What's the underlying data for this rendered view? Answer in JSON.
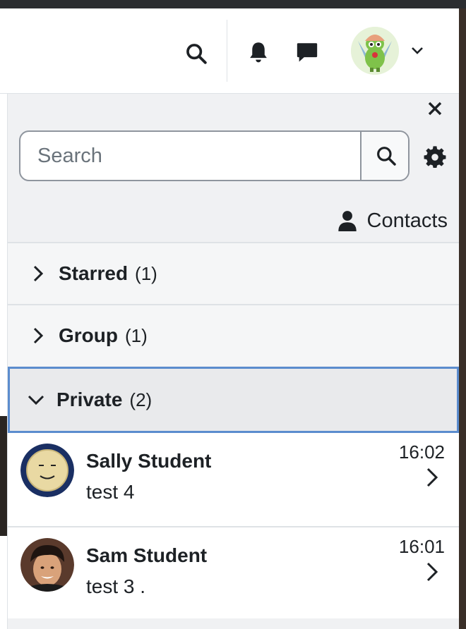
{
  "navbar": {
    "search_icon": "search-icon",
    "notifications_icon": "bell-icon",
    "messages_icon": "chat-bubble-icon",
    "user_menu_icon": "chevron-down-icon"
  },
  "drawer": {
    "search": {
      "placeholder": "Search"
    },
    "contacts_label": "Contacts",
    "sections": [
      {
        "label": "Starred",
        "count": "(1)",
        "expanded": false
      },
      {
        "label": "Group",
        "count": "(1)",
        "expanded": false
      },
      {
        "label": "Private",
        "count": "(2)",
        "expanded": true
      }
    ],
    "conversations": [
      {
        "name": "Sally Student",
        "last_message": "test 4",
        "time": "16:02"
      },
      {
        "name": "Sam Student",
        "last_message": "test 3 .",
        "time": "16:01"
      }
    ]
  },
  "colors": {
    "accent_focus": "#5b8cce",
    "text": "#1d2125",
    "drawer_bg": "#f0f1f3"
  }
}
